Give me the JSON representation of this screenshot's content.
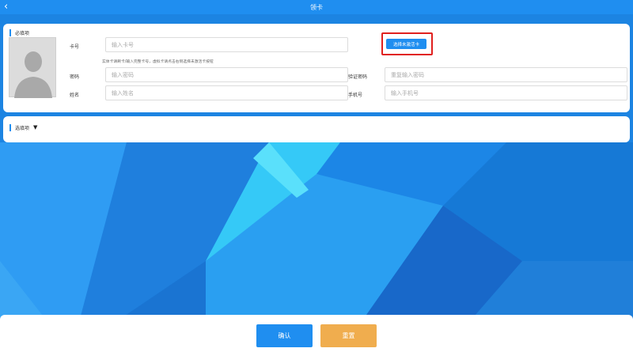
{
  "header": {
    "title": "领卡",
    "back_icon": "chevron-left-icon"
  },
  "required_section": {
    "title": "必填项",
    "card_no": {
      "label": "卡号",
      "placeholder": "输入卡号"
    },
    "hint": "实体卡请刷卡/输入完整卡号，虚拟卡请点击右侧选择未激活卡按钮",
    "select_button": "选择未激活卡",
    "password": {
      "label": "密码",
      "placeholder": "输入密码"
    },
    "confirm_password": {
      "label": "验证密码",
      "placeholder": "重复输入密码"
    },
    "name": {
      "label": "姓名",
      "placeholder": "输入姓名"
    },
    "phone": {
      "label": "手机号",
      "placeholder": "输入手机号"
    }
  },
  "optional_section": {
    "title": "选填项",
    "toggle_icon": "caret-down-icon"
  },
  "footer": {
    "confirm": "确认",
    "reset": "重置"
  },
  "colors": {
    "primary": "#1f8ef0",
    "reset": "#f0ad4e",
    "highlight": "#e0201e"
  }
}
